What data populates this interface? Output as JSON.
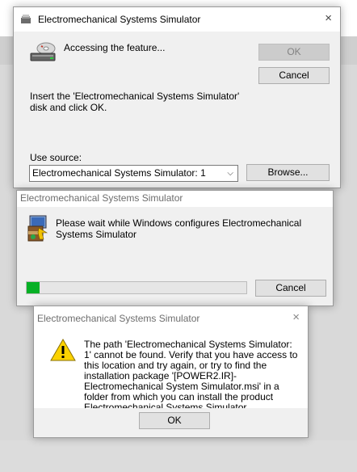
{
  "dialog1": {
    "title": "Electromechanical Systems Simulator",
    "heading": "Accessing the feature...",
    "message": "Insert the 'Electromechanical Systems Simulator' disk and click OK.",
    "use_source_label": "Use source:",
    "source_value": "Electromechanical Systems Simulator: 1",
    "ok_label": "OK",
    "cancel_label": "Cancel",
    "browse_label": "Browse..."
  },
  "dialog2": {
    "title": "Electromechanical Systems Simulator",
    "message": "Please wait while Windows configures Electromechanical Systems Simulator",
    "cancel_label": "Cancel",
    "progress_fraction": 0.06
  },
  "dialog3": {
    "title": "Electromechanical Systems Simulator",
    "message": "The path 'Electromechanical Systems Simulator: 1' cannot be found. Verify that you have access to this location and try again, or try to find the installation package '[POWER2.IR]-Electromechanical System Simulator.msi' in a folder from which you can install the product Electromechanical Systems Simulator.",
    "ok_label": "OK"
  },
  "colors": {
    "progress": "#06b025",
    "accent": "#0078d7",
    "warning": "#fbd200"
  },
  "icons": {
    "close": "×",
    "caret": "⌵"
  }
}
